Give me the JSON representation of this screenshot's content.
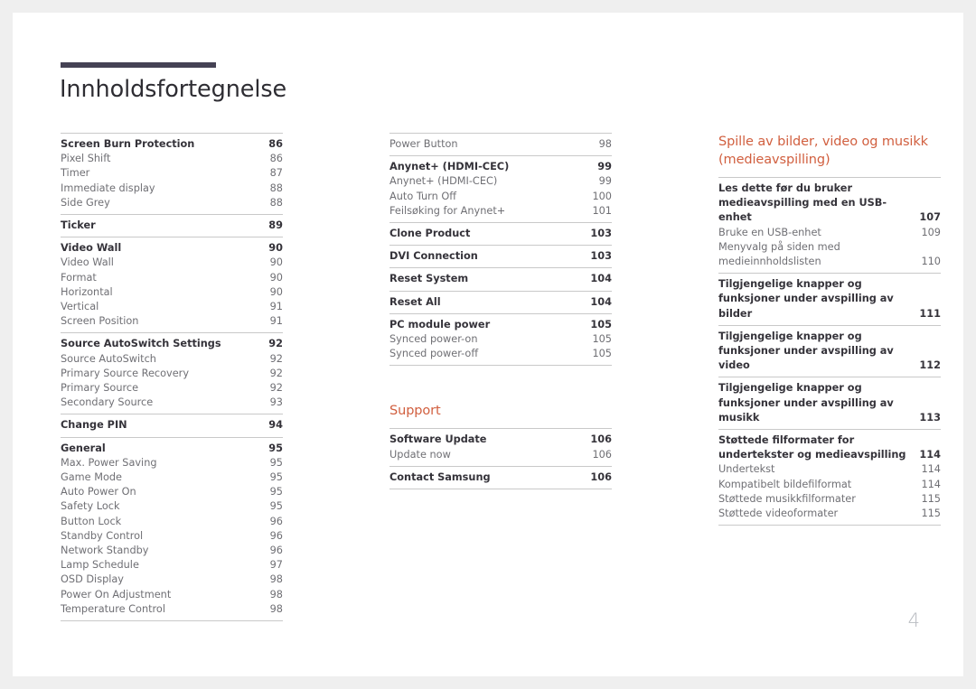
{
  "document": {
    "title": "Innholdsfortegnelse",
    "folio": "4"
  },
  "columns": [
    {
      "id": "column-1",
      "blocks": [
        {
          "type": "group",
          "entries": [
            {
              "label": "Screen Burn Protection",
              "page": "86",
              "level": "main"
            },
            {
              "label": "Pixel Shift",
              "page": "86",
              "level": "sub"
            },
            {
              "label": "Timer",
              "page": "87",
              "level": "sub"
            },
            {
              "label": "Immediate display",
              "page": "88",
              "level": "sub"
            },
            {
              "label": "Side Grey",
              "page": "88",
              "level": "sub"
            }
          ]
        },
        {
          "type": "group",
          "entries": [
            {
              "label": "Ticker",
              "page": "89",
              "level": "main"
            }
          ]
        },
        {
          "type": "group",
          "entries": [
            {
              "label": "Video Wall",
              "page": "90",
              "level": "main"
            },
            {
              "label": "Video Wall",
              "page": "90",
              "level": "sub"
            },
            {
              "label": "Format",
              "page": "90",
              "level": "sub"
            },
            {
              "label": "Horizontal",
              "page": "90",
              "level": "sub"
            },
            {
              "label": "Vertical",
              "page": "91",
              "level": "sub"
            },
            {
              "label": "Screen Position",
              "page": "91",
              "level": "sub"
            }
          ]
        },
        {
          "type": "group",
          "entries": [
            {
              "label": "Source AutoSwitch Settings",
              "page": "92",
              "level": "main"
            },
            {
              "label": "Source AutoSwitch",
              "page": "92",
              "level": "sub"
            },
            {
              "label": "Primary Source Recovery",
              "page": "92",
              "level": "sub"
            },
            {
              "label": "Primary Source",
              "page": "92",
              "level": "sub"
            },
            {
              "label": "Secondary Source",
              "page": "93",
              "level": "sub"
            }
          ]
        },
        {
          "type": "group",
          "entries": [
            {
              "label": "Change PIN",
              "page": "94",
              "level": "main"
            }
          ]
        },
        {
          "type": "group",
          "last": true,
          "entries": [
            {
              "label": "General",
              "page": "95",
              "level": "main"
            },
            {
              "label": "Max. Power Saving",
              "page": "95",
              "level": "sub"
            },
            {
              "label": "Game Mode",
              "page": "95",
              "level": "sub"
            },
            {
              "label": "Auto Power On",
              "page": "95",
              "level": "sub"
            },
            {
              "label": "Safety Lock",
              "page": "95",
              "level": "sub"
            },
            {
              "label": "Button Lock",
              "page": "96",
              "level": "sub"
            },
            {
              "label": "Standby Control",
              "page": "96",
              "level": "sub"
            },
            {
              "label": "Network Standby",
              "page": "96",
              "level": "sub"
            },
            {
              "label": "Lamp Schedule",
              "page": "97",
              "level": "sub"
            },
            {
              "label": "OSD Display",
              "page": "98",
              "level": "sub"
            },
            {
              "label": "Power On Adjustment",
              "page": "98",
              "level": "sub"
            },
            {
              "label": "Temperature Control",
              "page": "98",
              "level": "sub"
            }
          ]
        }
      ]
    },
    {
      "id": "column-2",
      "blocks": [
        {
          "type": "group",
          "entries": [
            {
              "label": "Power Button",
              "page": "98",
              "level": "sub"
            }
          ]
        },
        {
          "type": "group",
          "entries": [
            {
              "label": "Anynet+ (HDMI-CEC)",
              "page": "99",
              "level": "main"
            },
            {
              "label": "Anynet+ (HDMI-CEC)",
              "page": "99",
              "level": "sub"
            },
            {
              "label": "Auto Turn Off",
              "page": "100",
              "level": "sub"
            },
            {
              "label": "Feilsøking for Anynet+",
              "page": "101",
              "level": "sub"
            }
          ]
        },
        {
          "type": "group",
          "entries": [
            {
              "label": "Clone Product",
              "page": "103",
              "level": "main"
            }
          ]
        },
        {
          "type": "group",
          "entries": [
            {
              "label": "DVI Connection",
              "page": "103",
              "level": "main"
            }
          ]
        },
        {
          "type": "group",
          "entries": [
            {
              "label": "Reset System",
              "page": "104",
              "level": "main"
            }
          ]
        },
        {
          "type": "group",
          "entries": [
            {
              "label": "Reset All",
              "page": "104",
              "level": "main"
            }
          ]
        },
        {
          "type": "group",
          "last": true,
          "entries": [
            {
              "label": "PC module power",
              "page": "105",
              "level": "main"
            },
            {
              "label": "Synced power-on",
              "page": "105",
              "level": "sub"
            },
            {
              "label": "Synced power-off",
              "page": "105",
              "level": "sub"
            }
          ]
        },
        {
          "type": "heading",
          "text": "Support",
          "spaced": true
        },
        {
          "type": "group",
          "entries": [
            {
              "label": "Software Update",
              "page": "106",
              "level": "main"
            },
            {
              "label": "Update now",
              "page": "106",
              "level": "sub"
            }
          ]
        },
        {
          "type": "group",
          "last": true,
          "entries": [
            {
              "label": "Contact Samsung",
              "page": "106",
              "level": "main"
            }
          ]
        }
      ]
    },
    {
      "id": "column-3",
      "blocks": [
        {
          "type": "heading",
          "text": "Spille av bilder, video og musikk (medieavspilling)",
          "spaced": false
        },
        {
          "type": "group",
          "entries": [
            {
              "label": "Les dette før du bruker medieavspilling med en USB-enhet",
              "page": "107",
              "level": "main"
            },
            {
              "label": "Bruke en USB-enhet",
              "page": "109",
              "level": "sub"
            },
            {
              "label": "Menyvalg på siden med medieinnholdslisten",
              "page": "110",
              "level": "sub"
            }
          ]
        },
        {
          "type": "group",
          "entries": [
            {
              "label": "Tilgjengelige knapper og funksjoner under avspilling av bilder",
              "page": "111",
              "level": "main"
            }
          ]
        },
        {
          "type": "group",
          "entries": [
            {
              "label": "Tilgjengelige knapper og funksjoner under avspilling av video",
              "page": "112",
              "level": "main"
            }
          ]
        },
        {
          "type": "group",
          "entries": [
            {
              "label": "Tilgjengelige knapper og funksjoner under avspilling av musikk",
              "page": "113",
              "level": "main"
            }
          ]
        },
        {
          "type": "group",
          "last": true,
          "entries": [
            {
              "label": "Støttede filformater for undertekster og medieavspilling",
              "page": "114",
              "level": "main"
            },
            {
              "label": "Undertekst",
              "page": "114",
              "level": "sub"
            },
            {
              "label": "Kompatibelt bildefilformat",
              "page": "114",
              "level": "sub"
            },
            {
              "label": "Støttede musikkfilformater",
              "page": "115",
              "level": "sub"
            },
            {
              "label": "Støttede videoformater",
              "page": "115",
              "level": "sub"
            }
          ]
        }
      ]
    }
  ],
  "colors": {
    "accent": "#d15f3f",
    "title_rule": "#454254",
    "text_main": "#35333a",
    "text_sub": "#6f6f74",
    "separator": "#c9c9c9",
    "folio": "#b9bcc2",
    "page_background": "#efefef",
    "sheet": "#ffffff"
  }
}
